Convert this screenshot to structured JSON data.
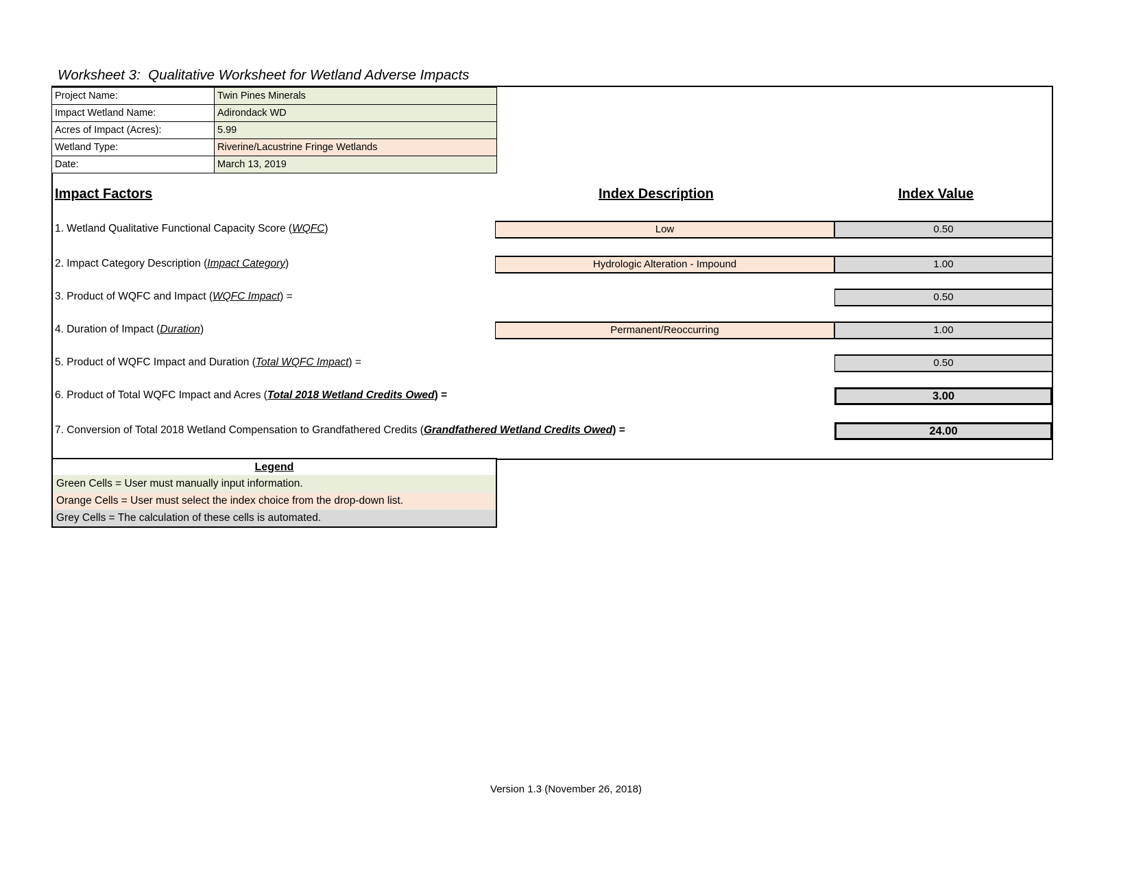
{
  "title": "Worksheet 3:  Qualitative Worksheet for Wetland Adverse Impacts",
  "info": {
    "rows": [
      {
        "label": "Project Name:",
        "value": "Twin Pines Minerals",
        "cell_type": "green"
      },
      {
        "label": "Impact Wetland Name:",
        "value": "Adirondack WD",
        "cell_type": "green"
      },
      {
        "label": "Acres of Impact (Acres):",
        "value": "5.99",
        "cell_type": "green"
      },
      {
        "label": "Wetland Type:",
        "value": "Riverine/Lacustrine Fringe Wetlands",
        "cell_type": "orange"
      },
      {
        "label": "Date:",
        "value": "March 13, 2019",
        "cell_type": "green"
      }
    ]
  },
  "headers": {
    "impact_factors": "Impact Factors",
    "index_description": "Index Description",
    "index_value": "Index Value"
  },
  "factors": [
    {
      "num": "1. ",
      "text_before": "Wetland Qualitative Functional Capacity Score (",
      "term": "WQFC",
      "text_after": ")",
      "term_style": "italic-underline",
      "description": "Low",
      "value": "0.50",
      "has_description": true,
      "emphasis": false
    },
    {
      "num": "2. ",
      "text_before": "Impact Category Description (",
      "term": "Impact Category",
      "text_after": ")",
      "term_style": "italic-underline",
      "description": "Hydrologic Alteration - Impound",
      "value": "1.00",
      "has_description": true,
      "emphasis": false
    },
    {
      "num": "3. ",
      "text_before": "Product of WQFC and Impact (",
      "term": "WQFC Impact",
      "text_after": ") =",
      "term_style": "italic-underline",
      "description": "",
      "value": "0.50",
      "has_description": false,
      "emphasis": false
    },
    {
      "num": "4. ",
      "text_before": "Duration of Impact (",
      "term": "Duration",
      "text_after": ")",
      "term_style": "italic-underline",
      "description": "Permanent/Reoccurring",
      "value": "1.00",
      "has_description": true,
      "emphasis": false
    },
    {
      "num": "5. ",
      "text_before": "Product of WQFC Impact and Duration (",
      "term": "Total WQFC Impact",
      "text_after": ") =",
      "term_style": "italic-underline",
      "description": "",
      "value": "0.50",
      "has_description": false,
      "emphasis": false
    },
    {
      "num": "6. ",
      "text_before": "Product of Total WQFC Impact and Acres (",
      "term": "Total 2018 Wetland Credits Owed",
      "text_after": ") =",
      "term_style": "bold-italic-underline",
      "description": "",
      "value": "3.00",
      "has_description": false,
      "emphasis": true
    },
    {
      "num": "7. ",
      "text_before": "Conversion of Total 2018 Wetland Compensation to Grandfathered Credits (",
      "term": "Grandfathered Wetland Credits Owed",
      "text_after": ") =",
      "term_style": "bold-italic-underline",
      "description": "",
      "value": "24.00",
      "has_description": false,
      "emphasis": true
    }
  ],
  "legend": {
    "title": "Legend",
    "rows": [
      {
        "text": "Green Cells = User must manually input information.",
        "cell_type": "green"
      },
      {
        "text": "Orange Cells = User must select the index choice from the drop-down list.",
        "cell_type": "orange"
      },
      {
        "text": "Grey Cells = The calculation of these cells is automated.",
        "cell_type": "grey"
      }
    ]
  },
  "footer": {
    "version": "Version 1.3 (November 26, 2018)"
  },
  "colors": {
    "green_cell": "#e9eeda",
    "orange_cell": "#fbe5d6",
    "grey_cell": "#d9d9d9",
    "border": "#000000"
  }
}
